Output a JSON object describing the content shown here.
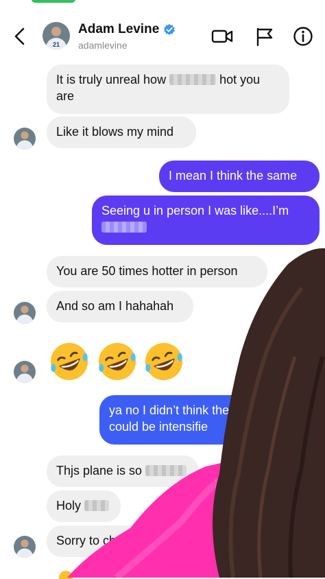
{
  "header": {
    "name": "Adam Levine",
    "handle": "adamlevine",
    "icons": [
      "back-chevron-icon",
      "verified-badge-icon",
      "video-call-icon",
      "flag-icon",
      "info-icon"
    ]
  },
  "messages": {
    "m1_line1": "It is truly unreal how",
    "m1_line1_after": "hot you",
    "m1_line2": "are",
    "m2": "Like it blows my mind",
    "m3": "I mean I think the same",
    "m4_line1": "Seeing u in person I was like....I’m",
    "m5": "You are 50 times hotter in person",
    "m6": "And so am I hahahah",
    "m7_emojis": "🤣🤣🤣",
    "m8_line1": "ya no I didn’t think the",
    "m8_line2": "could be intensifie",
    "m9": "Thjs plane is so",
    "m10": "Holy",
    "m11": "Sorry to ch"
  },
  "colors": {
    "outgoing_purple": "#5b3cf2",
    "outgoing_blue": "#3c5ef5",
    "incoming_gray": "#efefef",
    "overlay_pink": "#ff2fae",
    "hair_brown": "#3a2622"
  }
}
